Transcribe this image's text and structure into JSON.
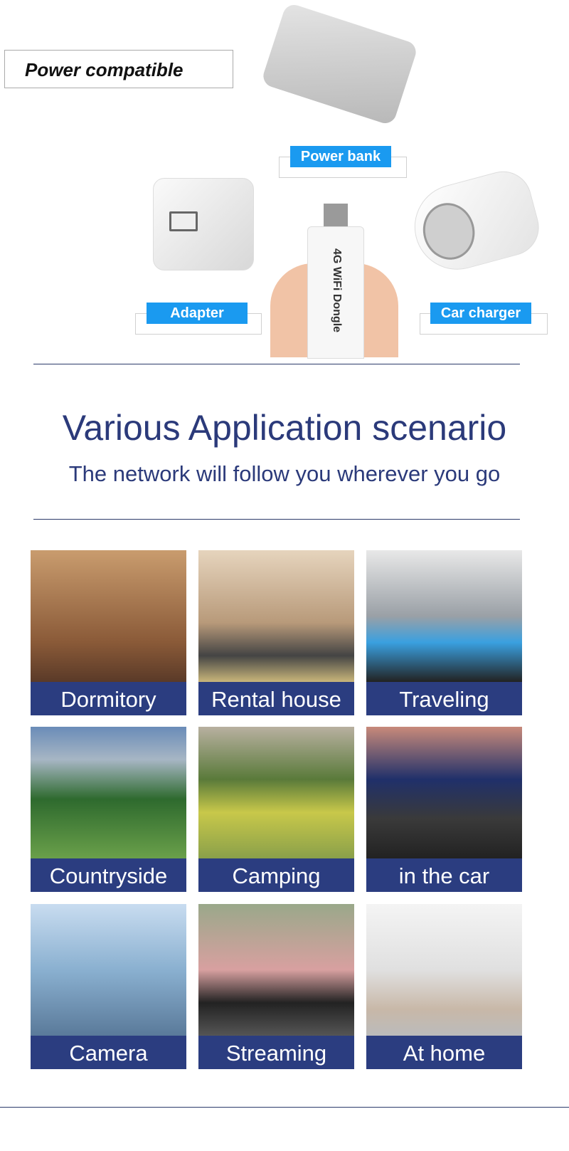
{
  "power": {
    "title": "Power compatible",
    "items": [
      {
        "label": "Power bank",
        "icon": "power-bank-image"
      },
      {
        "label": "Adapter",
        "icon": "wall-adapter-image"
      },
      {
        "label": "Car charger",
        "icon": "car-charger-image"
      }
    ],
    "dongle_text": "4G WiFi Dongle"
  },
  "scenario": {
    "title": "Various Application scenario",
    "subtitle": "The network will follow you wherever you go",
    "tiles": [
      {
        "label": "Dormitory"
      },
      {
        "label": "Rental house"
      },
      {
        "label": "Traveling"
      },
      {
        "label": "Countryside"
      },
      {
        "label": "Camping"
      },
      {
        "label": "in the car"
      },
      {
        "label": "Camera"
      },
      {
        "label": "Streaming"
      },
      {
        "label": "At home"
      }
    ]
  },
  "colors": {
    "tag_blue": "#1a9af0",
    "navy": "#2b3d80",
    "heading": "#2b3a7a"
  }
}
